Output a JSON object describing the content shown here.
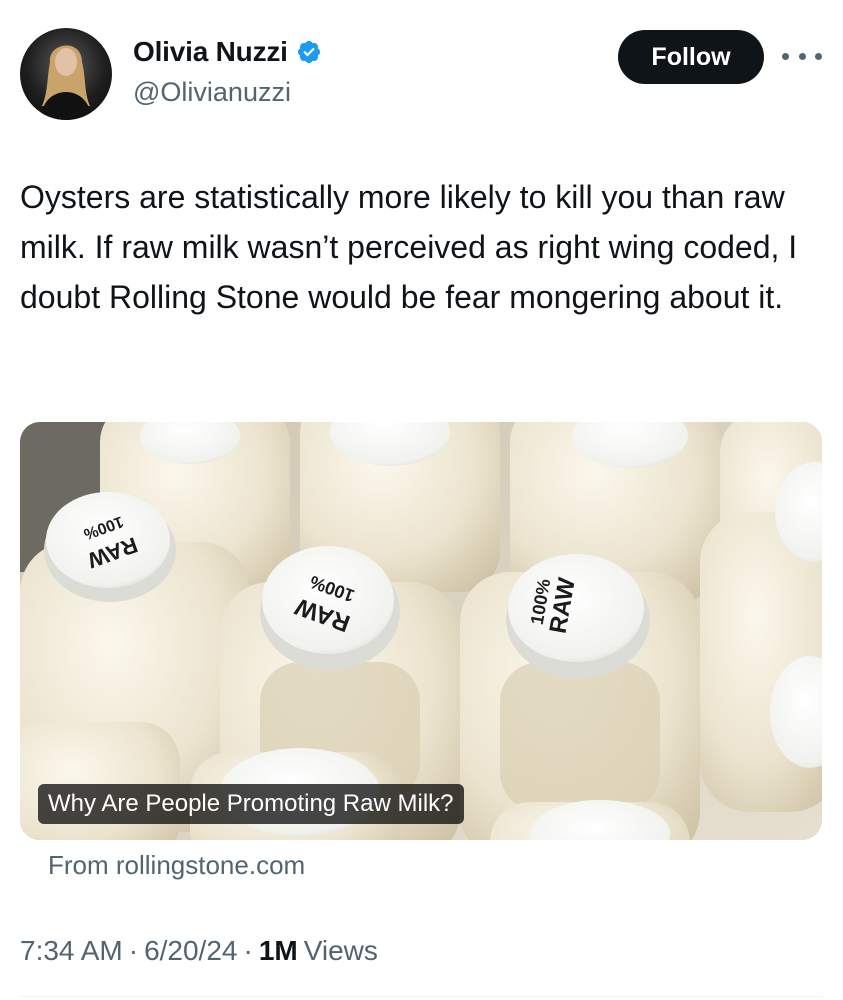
{
  "author": {
    "display_name": "Olivia Nuzzi",
    "handle": "@Olivianuzzi",
    "verified": true,
    "verified_color": "#1d9bf0"
  },
  "actions": {
    "follow_label": "Follow"
  },
  "tweet": {
    "text": "Oysters are statistically more likely to kill you than raw milk. If raw milk wasn’t perceived as right wing coded, I doubt Rolling Stone would be fear mongering about it."
  },
  "card": {
    "title": "Why Are People Promoting Raw Milk?",
    "source": "From rollingstone.com",
    "cap_text_top": "100%",
    "cap_text_bottom": "RAW"
  },
  "meta": {
    "time": "7:34 AM",
    "separator": "·",
    "date": "6/20/24",
    "views_count": "1M",
    "views_label": "Views"
  },
  "colors": {
    "text_primary": "#0f1419",
    "text_secondary": "#536471",
    "button_bg": "#0f1419"
  }
}
